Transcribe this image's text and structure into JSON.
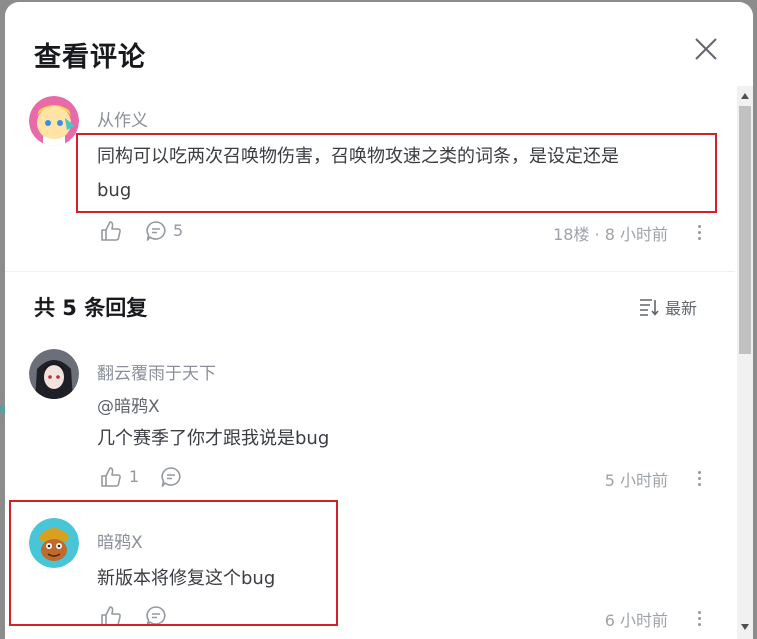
{
  "modal": {
    "title": "查看评论"
  },
  "main_comment": {
    "username": "从作义",
    "text": "同构可以吃两次召唤物伤害，召唤物攻速之类的词条，是设定还是bug",
    "text_line1": "同构可以吃两次召唤物伤害，召唤物攻速之类的词条，是设定还是",
    "text_line2": "bug",
    "reply_count": "5",
    "floor_time": "18楼 · 8 小时前"
  },
  "replies_header": {
    "total": "共 5 条回复",
    "sort_label": "最新"
  },
  "replies": [
    {
      "username": "翻云覆雨于天下",
      "mention": "@暗鸦X",
      "text": "几个赛季了你才跟我说是bug",
      "likes": "1",
      "time": "5 小时前"
    },
    {
      "username": "暗鸦X",
      "text": "新版本将修复这个bug",
      "likes": "",
      "time": "6 小时前"
    }
  ],
  "colors": {
    "highlight": "#d1222a",
    "muted": "#9499a0"
  }
}
